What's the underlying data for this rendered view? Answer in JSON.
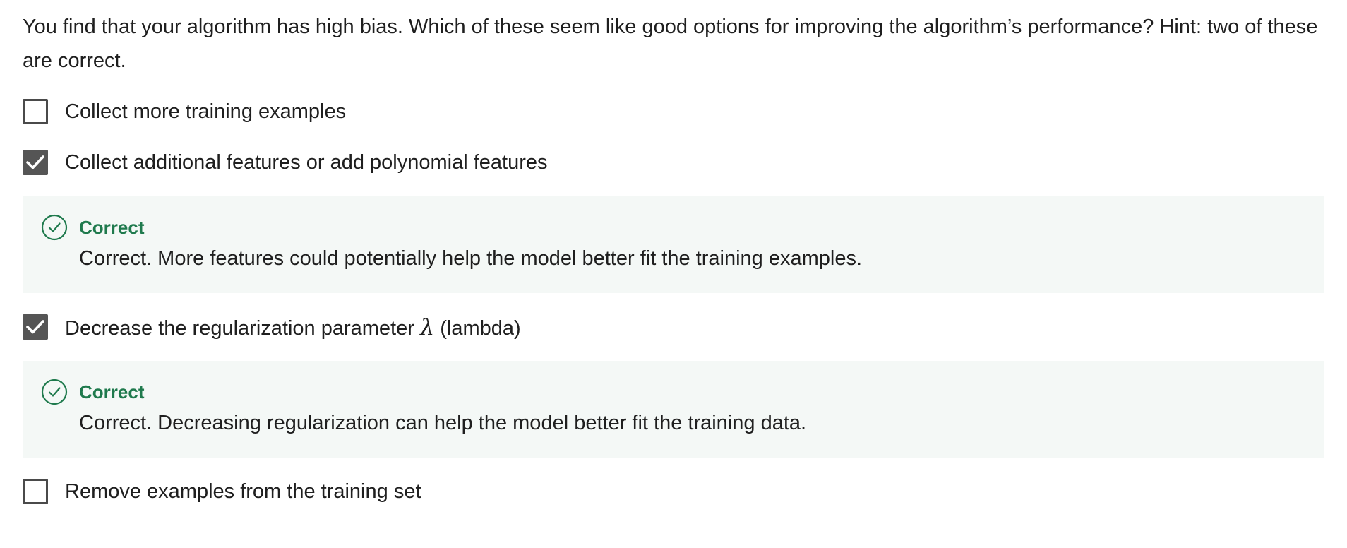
{
  "question": {
    "text": "You find that your algorithm has high bias. Which of these seem like good options for improving the algorithm’s performance? Hint: two of these are correct."
  },
  "options": [
    {
      "label": "Collect more training examples",
      "checked": false
    },
    {
      "label": "Collect additional features or add polynomial features",
      "checked": true,
      "feedback": {
        "title": "Correct",
        "body": "Correct. More features could potentially help the model better fit the training examples."
      }
    },
    {
      "label_before": "Decrease the regularization parameter ",
      "symbol": "λ",
      "label_after": " (lambda)",
      "checked": true,
      "feedback": {
        "title": "Correct",
        "body": "Correct. Decreasing regularization can help the model better fit the training data."
      }
    },
    {
      "label": "Remove examples from the training set",
      "checked": false
    }
  ],
  "colors": {
    "correct_green": "#1f7a4d",
    "feedback_bg": "#f4f8f6",
    "checkbox_checked": "#555555"
  },
  "icons": {
    "checked": "checkmark-icon",
    "feedback": "check-circle-icon"
  }
}
